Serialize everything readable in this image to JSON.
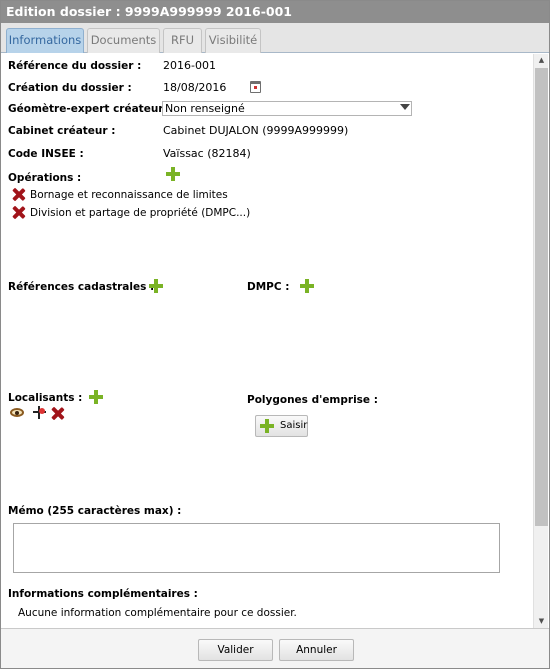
{
  "window": {
    "title": "Edition dossier : 9999A999999 2016-001"
  },
  "tabs": [
    {
      "label": "Informations",
      "active": true
    },
    {
      "label": "Documents",
      "active": false
    },
    {
      "label": "RFU",
      "active": false
    },
    {
      "label": "Visibilité",
      "active": false
    }
  ],
  "form": {
    "reference": {
      "label": "Référence du dossier  :",
      "value": "2016-001"
    },
    "creation": {
      "label": "Création du dossier  :",
      "value": "18/08/2016"
    },
    "geometre": {
      "label": "Géomètre-expert créateur :",
      "value": "Non renseigné"
    },
    "cabinet": {
      "label": "Cabinet créateur :",
      "value": "Cabinet DUJALON (9999A999999)"
    },
    "insee": {
      "label": "Code INSEE  :",
      "value": "Vaïssac (82184)"
    },
    "operations": {
      "label": "Opérations :",
      "items": [
        "Bornage et reconnaissance de limites",
        "Division et partage de propriété (DMPC...)"
      ]
    },
    "references_cadastrales": {
      "label": "Références cadastrales :"
    },
    "dmpc": {
      "label": "DMPC :"
    },
    "localisants": {
      "label": "Localisants :"
    },
    "polygones": {
      "label": "Polygones d'emprise :",
      "button": "Saisir"
    },
    "memo": {
      "label": "Mémo (255 caractères max) :",
      "value": ""
    },
    "infos": {
      "label": "Informations complémentaires :",
      "text": "Aucune information complémentaire pour ce dossier."
    }
  },
  "footer": {
    "valider": "Valider",
    "annuler": "Annuler"
  },
  "colors": {
    "titlebar": "#8e8e8e",
    "active_tab": "#b7d3ea",
    "plus_green": "#7ab325",
    "delete_red": "#a1141a"
  },
  "icons": [
    "calendar-icon",
    "plus-icon",
    "delete-icon",
    "eye-icon",
    "target-icon",
    "chevron-down-icon",
    "scroll-up-icon",
    "scroll-down-icon"
  ]
}
